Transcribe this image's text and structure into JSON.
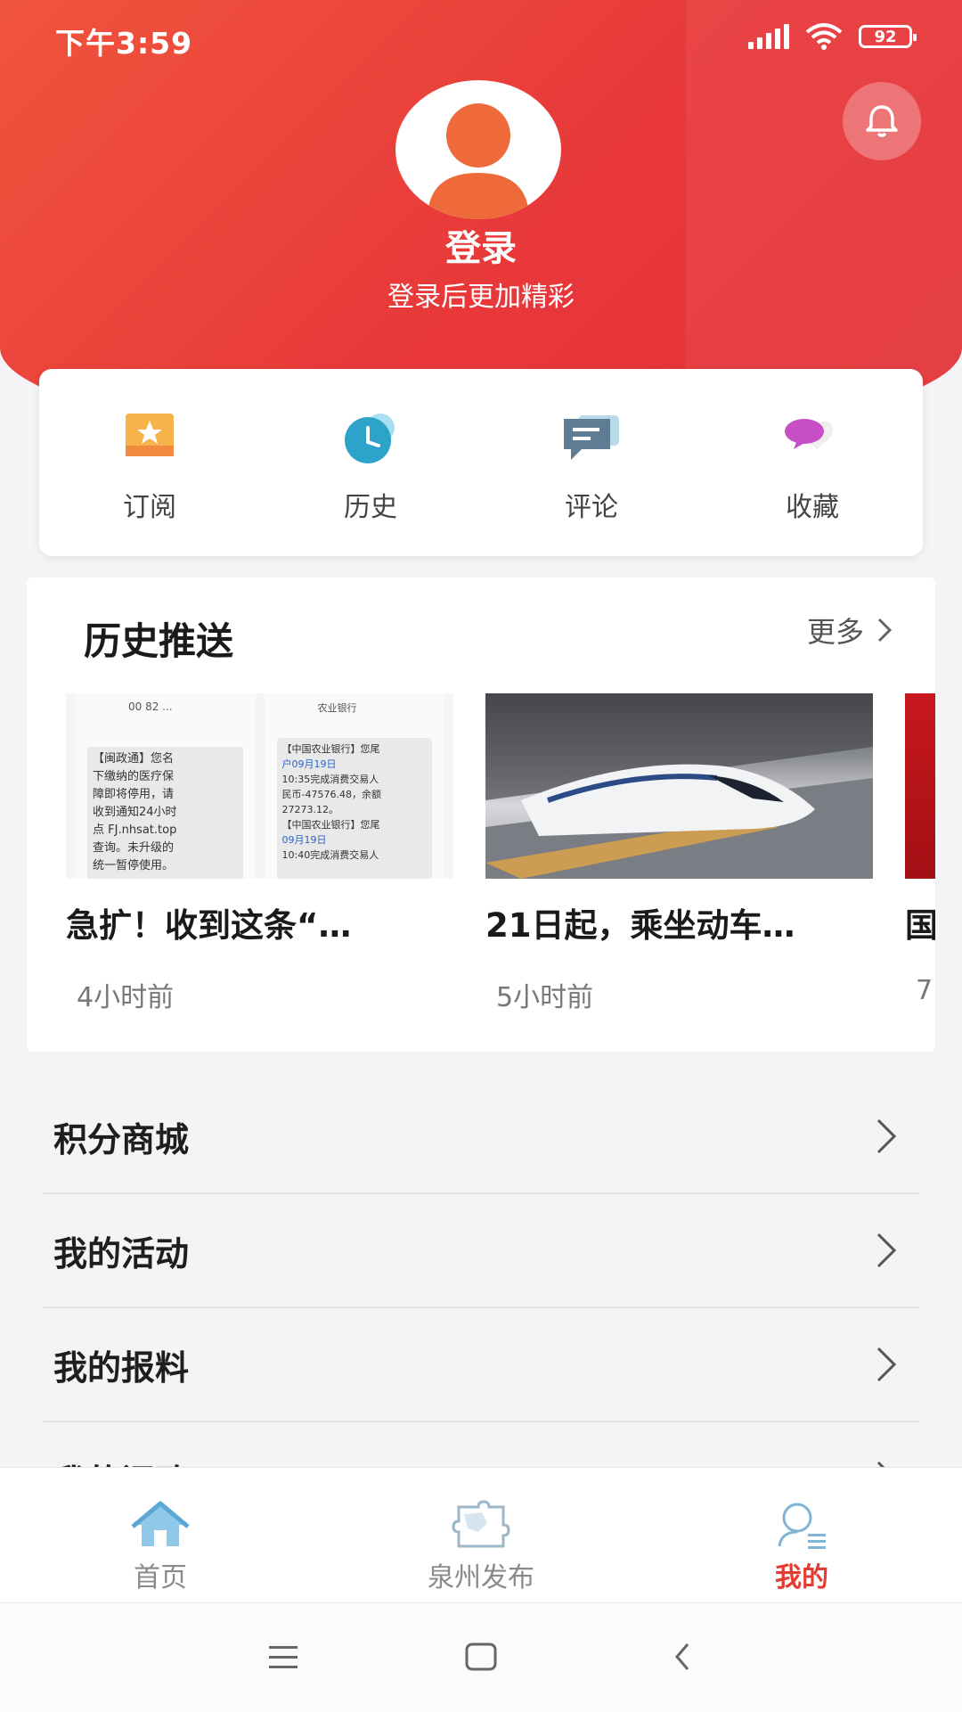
{
  "status_bar": {
    "time": "下午3:59",
    "battery": "92"
  },
  "profile": {
    "login_label": "登录",
    "login_subtitle": "登录后更加精彩"
  },
  "quick_actions": [
    {
      "label": "订阅",
      "icon": "subscribe-icon"
    },
    {
      "label": "历史",
      "icon": "history-clock-icon"
    },
    {
      "label": "评论",
      "icon": "comment-icon"
    },
    {
      "label": "收藏",
      "icon": "favorite-heart-icon"
    }
  ],
  "history_push": {
    "title": "历史推送",
    "more_label": "更多",
    "items": [
      {
        "title": "急扩！收到这条“…",
        "time": "4小时前",
        "sms_left": [
          "00 82 ...",
          "【闽政通】您名",
          "下缴纳的医疗保",
          "障即将停用，请",
          "收到通知24小时",
          "点 FJ.nhsat.top",
          "查询。未升级的",
          "统一暂停使用。"
        ],
        "sms_right": [
          "农业银行",
          "【中国农业银行】您尾",
          "户09月19日",
          "10:35完成消费交易人",
          "民币-47576.48，余额",
          "27273.12。",
          "【中国农业银行】您尾",
          "09月19日",
          "10:40完成消费交易人"
        ]
      },
      {
        "title": "21日起，乘坐动车…",
        "time": "5小时前"
      },
      {
        "title": "国",
        "time": "7"
      }
    ]
  },
  "menu": [
    {
      "label": "积分商城"
    },
    {
      "label": "我的活动"
    },
    {
      "label": "我的报料"
    },
    {
      "label": "我的问政"
    }
  ],
  "bottom_nav": [
    {
      "label": "首页",
      "icon": "home-icon"
    },
    {
      "label": "泉州发布",
      "icon": "puzzle-map-icon"
    },
    {
      "label": "我的",
      "icon": "profile-search-icon"
    }
  ],
  "colors": {
    "brand_red": "#e8383a",
    "active_tab": "#e33d33"
  }
}
